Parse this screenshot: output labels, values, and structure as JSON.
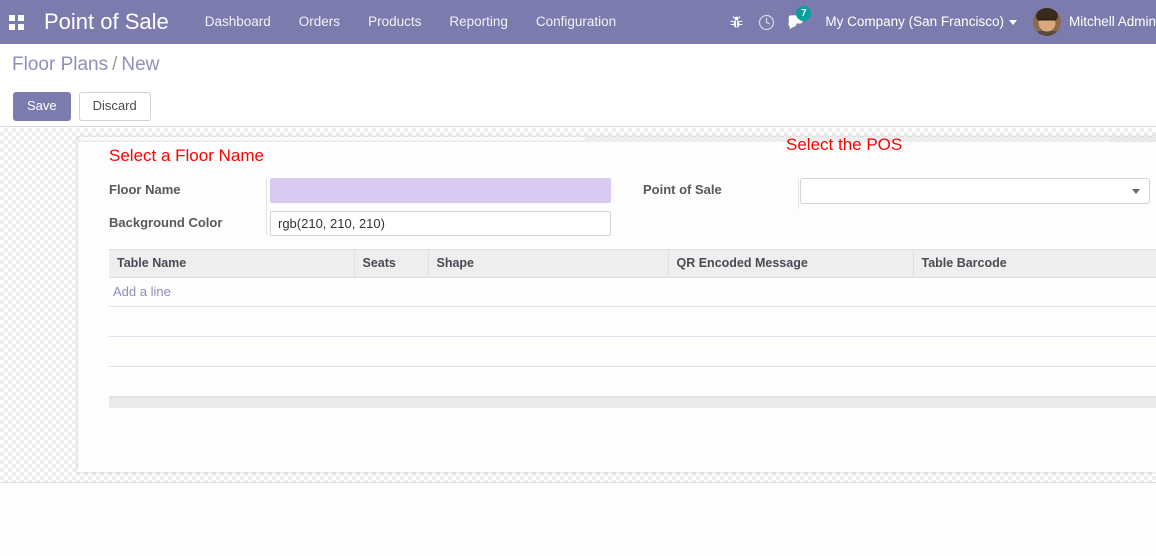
{
  "navbar": {
    "apps_icon": "apps-grid-icon",
    "brand": "Point of Sale",
    "menu": [
      {
        "label": "Dashboard"
      },
      {
        "label": "Orders"
      },
      {
        "label": "Products"
      },
      {
        "label": "Reporting"
      },
      {
        "label": "Configuration"
      }
    ],
    "icons": [
      {
        "name": "bug-icon"
      },
      {
        "name": "clock-icon"
      },
      {
        "name": "messages-icon"
      }
    ],
    "messages_count": "7",
    "company": "My Company (San Francisco)",
    "user_name": "Mitchell Admin",
    "avatar_name": "avatar",
    "brand_color": "#7c7bad",
    "badge_color": "#00a09d"
  },
  "control_panel": {
    "breadcrumb_root": "Floor Plans",
    "breadcrumb_separator": "/",
    "breadcrumb_current": "New",
    "save_label": "Save",
    "discard_label": "Discard"
  },
  "annotations": {
    "floor_name": "Select a Floor Name",
    "pos": "Select the POS",
    "color": "#ff0000"
  },
  "form": {
    "floor_name": {
      "label": "Floor Name",
      "value": "",
      "placeholder": "",
      "focused_color": "#d8caf0"
    },
    "background_color": {
      "label": "Background Color",
      "value": "rgb(210, 210, 210)",
      "placeholder": ""
    },
    "point_of_sale": {
      "label": "Point of Sale",
      "value": "",
      "placeholder": "",
      "caret_icon": "chevron-down-icon"
    }
  },
  "tables_list": {
    "columns": [
      "Table Name",
      "Seats",
      "Shape",
      "QR Encoded Message",
      "Table Barcode"
    ],
    "rows": [],
    "add_line_label": "Add a line",
    "empty_row_count": 3
  }
}
